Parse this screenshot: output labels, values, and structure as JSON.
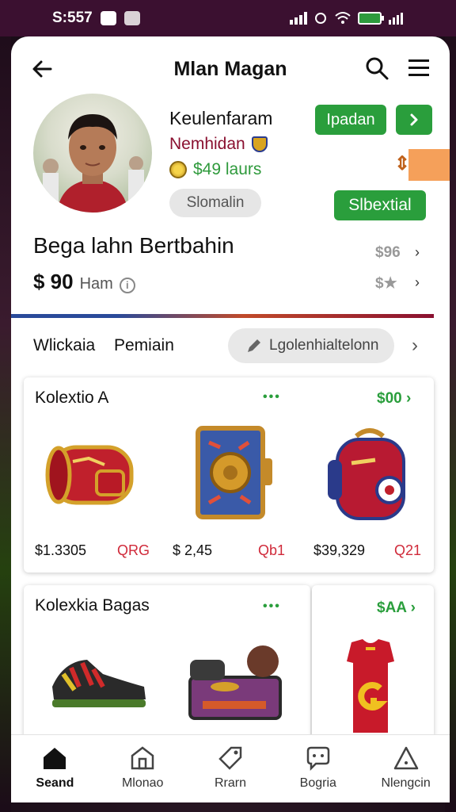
{
  "status_bar": {
    "time": "S:557"
  },
  "header": {
    "title": "Mlan Magan"
  },
  "profile": {
    "name": "Keulenfaram",
    "subtitle": "Nemhidan",
    "coins": "$49 laurs",
    "badge": "Slomalin",
    "update_button": "Ipadan",
    "select_button": "Slbextial"
  },
  "summary": {
    "title": "Bega lahn Bertbahin",
    "balance": "$ 90",
    "balance_unit": "Ham",
    "value_top": "$96",
    "value_bottom": "$★"
  },
  "tabs": {
    "first": "Wlickaia",
    "second": "Pemiain",
    "search_text": "Lgolenhialtelonn"
  },
  "collection_a": {
    "title": "Kolextio A",
    "link": "$00",
    "items": [
      {
        "icon": "red-bag-icon",
        "price": "$1.3305",
        "tag": "QRG"
      },
      {
        "icon": "card-case-icon",
        "price": "$ 2,45",
        "tag": "Qb1"
      },
      {
        "icon": "backpack-icon",
        "price": "$39,329",
        "tag": "Q21"
      }
    ]
  },
  "collection_b": {
    "title": "Kolexkia Bagas",
    "link": "$AA"
  },
  "nav": [
    {
      "label": "Seand",
      "icon": "home-icon"
    },
    {
      "label": "Mlonao",
      "icon": "store-icon"
    },
    {
      "label": "Rrarn",
      "icon": "tag-icon"
    },
    {
      "label": "Bogria",
      "icon": "chat-icon"
    },
    {
      "label": "Nlengcin",
      "icon": "alert-icon"
    }
  ],
  "colors": {
    "accent_green": "#2a9e3c",
    "brand_maroon": "#8a1030",
    "status_bar": "#3b1030"
  }
}
